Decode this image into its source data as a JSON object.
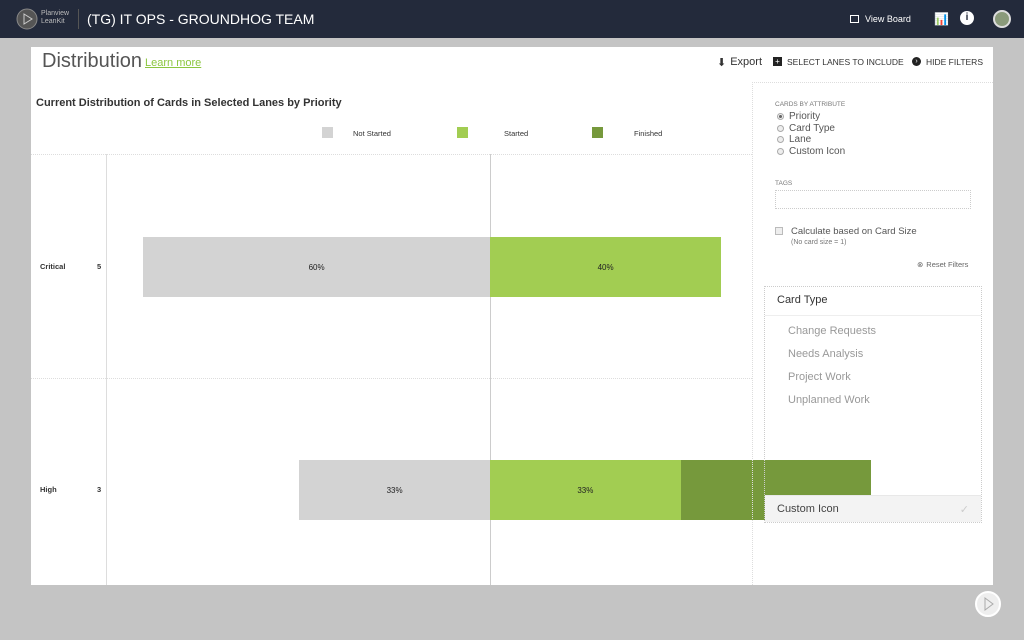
{
  "header": {
    "logo_line1": "Planview",
    "logo_line2": "LeanKit",
    "board_title": "(TG) IT OPS - GROUNDHOG TEAM",
    "view_board": "View Board"
  },
  "page": {
    "title": "Distribution",
    "learn_more": "Learn more",
    "export": "Export",
    "select_lanes": "SELECT LANES TO INCLUDE",
    "hide_filters": "HIDE FILTERS"
  },
  "filters": {
    "section_label": "CARDS BY ATTRIBUTE",
    "options": [
      "Priority",
      "Card Type",
      "Lane",
      "Custom Icon"
    ],
    "selected": "Priority",
    "tags_label": "TAGS",
    "tags_value": "",
    "calc_label": "Calculate based on Card Size",
    "calc_note": "(No card size = 1)",
    "calc_checked": false,
    "reset": "Reset Filters"
  },
  "card_type_box": {
    "title": "Card Type",
    "items": [
      "Change Requests",
      "Needs Analysis",
      "Project Work",
      "Unplanned Work"
    ],
    "footer": "Custom Icon"
  },
  "colors": {
    "not_started": "#d3d3d3",
    "started": "#a2cd52",
    "finished": "#76993c",
    "header": "#232a3b",
    "link": "#8cc63f"
  },
  "chart_data": {
    "type": "bar",
    "orientation": "horizontal",
    "stacked": true,
    "title": "Current Distribution of Cards in Selected Lanes by Priority",
    "categories": [
      "Critical",
      "High"
    ],
    "counts": [
      5,
      3
    ],
    "series": [
      {
        "name": "Not Started",
        "values": [
          60,
          33
        ],
        "labels": [
          "60%",
          "33%"
        ]
      },
      {
        "name": "Started",
        "values": [
          40,
          33
        ],
        "labels": [
          "40%",
          "33%"
        ]
      },
      {
        "name": "Finished",
        "values": [
          0,
          33
        ],
        "labels": [
          "",
          ""
        ]
      }
    ],
    "legend_position": "top"
  }
}
